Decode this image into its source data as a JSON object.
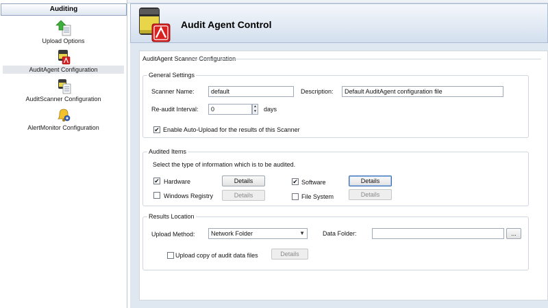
{
  "sidebar": {
    "header": "Auditing",
    "items": [
      {
        "label": "Upload Options",
        "icon": "upload-arrow-icon",
        "selected": false
      },
      {
        "label": "AuditAgent Configuration",
        "icon": "audit-agent-icon",
        "selected": true
      },
      {
        "label": "AuditScanner Configuration",
        "icon": "audit-scanner-icon",
        "selected": false
      },
      {
        "label": "AlertMonitor Configuration",
        "icon": "alert-bell-icon",
        "selected": false
      }
    ]
  },
  "header": {
    "title": "Audit Agent Control",
    "icon": "audit-agent-large-icon"
  },
  "config": {
    "group_title": "AuditAgent Scanner Configuration",
    "general": {
      "title": "General Settings",
      "scanner_name_label": "Scanner Name:",
      "scanner_name_value": "default",
      "description_label": "Description:",
      "description_value": "Default AuditAgent configuration file",
      "reaudit_label": "Re-audit Interval:",
      "reaudit_value": "0",
      "reaudit_unit": "days",
      "auto_upload_label": "Enable Auto-Upload for the results of this Scanner",
      "auto_upload_checked": true
    },
    "audited": {
      "title": "Audited Items",
      "instruction": "Select the type of information which is to be audited.",
      "hardware_label": "Hardware",
      "hardware_checked": true,
      "software_label": "Software",
      "software_checked": true,
      "registry_label": "Windows Registry",
      "registry_checked": false,
      "filesystem_label": "File System",
      "filesystem_checked": false,
      "details_label": "Details"
    },
    "results": {
      "title": "Results Location",
      "upload_method_label": "Upload Method:",
      "upload_method_value": "Network Folder",
      "data_folder_label": "Data Folder:",
      "data_folder_value": "",
      "browse_label": "...",
      "upload_copy_label": "Upload copy of audit data files",
      "upload_copy_checked": false,
      "details_label": "Details"
    }
  },
  "checkmark": "✔"
}
